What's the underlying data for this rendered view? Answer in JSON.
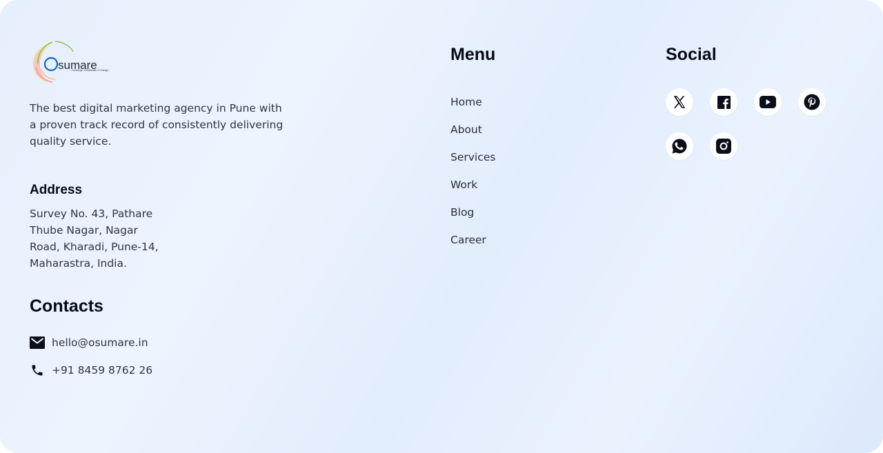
{
  "brand": {
    "logo_text": "sumare",
    "logo_initial": "O",
    "logo_tagline": "Converge, Collaborate & Change...",
    "tagline": "The best digital marketing agency in Pune with a proven track record of consistently delivering quality service."
  },
  "address": {
    "heading": "Address",
    "lines": [
      "Survey No. 43, Pathare",
      "Thube Nagar, Nagar",
      "Road, Kharadi, Pune-14,",
      "Maharastra, India."
    ]
  },
  "contacts": {
    "heading": "Contacts",
    "email": "hello@osumare.in",
    "phone": "+91 8459 8762 26"
  },
  "menu": {
    "heading": "Menu",
    "items": [
      {
        "label": "Home"
      },
      {
        "label": "About"
      },
      {
        "label": "Services"
      },
      {
        "label": "Work"
      },
      {
        "label": "Blog"
      },
      {
        "label": "Career"
      }
    ]
  },
  "social": {
    "heading": "Social",
    "items": [
      {
        "icon": "x-icon"
      },
      {
        "icon": "facebook-icon"
      },
      {
        "icon": "youtube-icon"
      },
      {
        "icon": "pinterest-icon"
      },
      {
        "icon": "whatsapp-icon"
      },
      {
        "icon": "instagram-icon"
      }
    ]
  },
  "colors": {
    "heading": "#070b16",
    "body_text": "#2f3440",
    "background_start": "#e6effc",
    "background_end": "#dce9fb",
    "icon_fill": "#0b0f1a"
  }
}
